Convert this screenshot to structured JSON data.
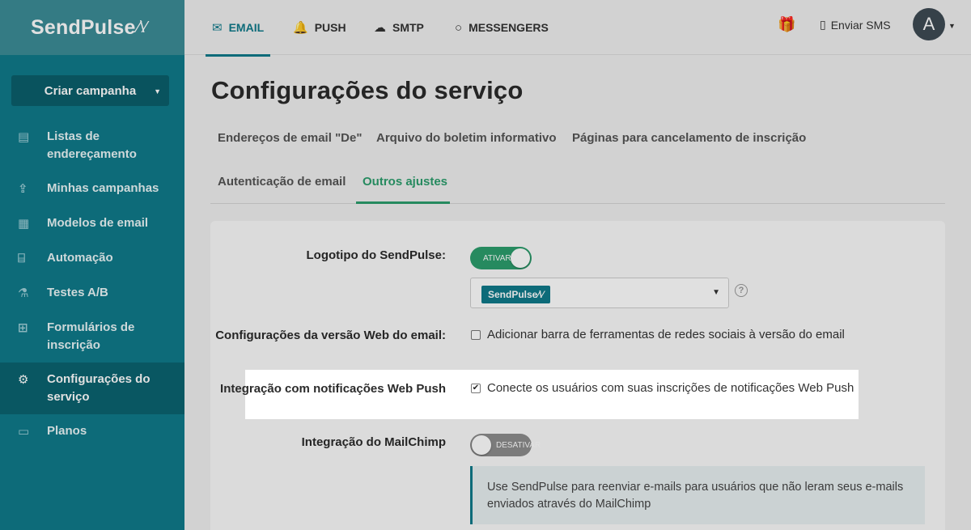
{
  "logo": {
    "text": "SendPulse",
    "pulse": "⁄\\⁄"
  },
  "sidebar": {
    "create_button": "Criar campanha",
    "items": [
      {
        "icon": "address-list-icon",
        "glyph": "▤",
        "label": "Listas de endereçamento"
      },
      {
        "icon": "campaigns-icon",
        "glyph": "⇪",
        "label": "Minhas campanhas"
      },
      {
        "icon": "templates-icon",
        "glyph": "▦",
        "label": "Modelos de email"
      },
      {
        "icon": "automation-icon",
        "glyph": "⌸",
        "label": "Automação"
      },
      {
        "icon": "ab-test-icon",
        "glyph": "⚗",
        "label": "Testes A/B"
      },
      {
        "icon": "forms-icon",
        "glyph": "⊞",
        "label": "Formulários de inscrição"
      },
      {
        "icon": "settings-icon",
        "glyph": "⚙",
        "label": "Configurações do serviço"
      },
      {
        "icon": "plans-icon",
        "glyph": "▭",
        "label": "Planos"
      }
    ]
  },
  "topbar": {
    "tabs": [
      {
        "icon": "email-icon",
        "glyph": "✉",
        "label": "EMAIL"
      },
      {
        "icon": "push-bell-icon",
        "glyph": "🔔",
        "label": "PUSH"
      },
      {
        "icon": "cloud-upload-icon",
        "glyph": "☁",
        "label": "SMTP"
      },
      {
        "icon": "chat-bubble-icon",
        "glyph": "○",
        "label": "MESSENGERS"
      }
    ],
    "sms_label": "Enviar SMS",
    "avatar_letter": "A"
  },
  "page": {
    "title": "Configurações do serviço",
    "subtabs": [
      "Endereços de email \"De\"",
      "Arquivo do boletim informativo",
      "Páginas para cancelamento de inscrição",
      "Autenticação de email",
      "Outros ajustes"
    ]
  },
  "settings": {
    "logo_label": "Logotipo do SendPulse:",
    "logo_toggle": "ATIVAR",
    "logo_select_badge": "SendPulse⁄\\⁄",
    "web_label": "Configurações da versão Web do email:",
    "web_checkbox": "Adicionar barra de ferramentas de redes sociais à versão do email",
    "push_label": "Integração com notificações Web Push",
    "push_checkbox": "Conecte os usuários com suas inscrições de notificações Web Push",
    "mailchimp_label": "Integração do MailChimp",
    "mailchimp_toggle": "DESATIVAR",
    "mailchimp_info": "Use SendPulse para reenviar e-mails para usuários que não leram seus e-mails enviados através do MailChimp"
  },
  "colors": {
    "brand": "#0f7a8a",
    "accent_green": "#2c9e6d"
  }
}
